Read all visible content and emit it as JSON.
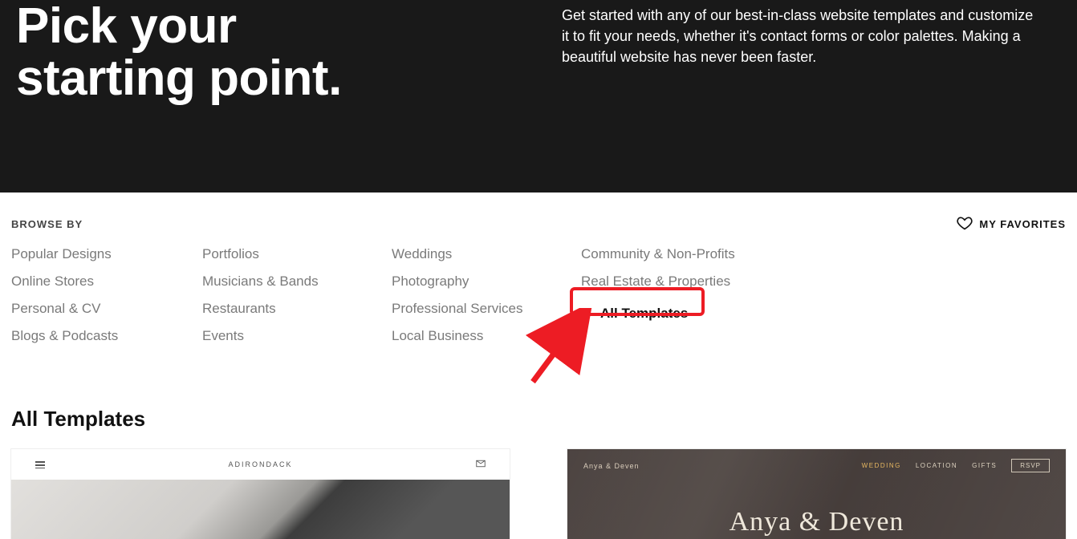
{
  "hero": {
    "title_line1": "Pick your",
    "title_line2": "starting point.",
    "description": "Get started with any of our best-in-class website templates and customize it to fit your needs, whether it's contact forms or color palettes. Making a beautiful website has never been faster."
  },
  "browse": {
    "label": "BROWSE BY",
    "favorites_label": "MY FAVORITES",
    "columns": [
      [
        "Popular Designs",
        "Online Stores",
        "Personal & CV",
        "Blogs & Podcasts"
      ],
      [
        "Portfolios",
        "Musicians & Bands",
        "Restaurants",
        "Events"
      ],
      [
        "Weddings",
        "Photography",
        "Professional Services",
        "Local Business"
      ],
      [
        "Community & Non-Profits",
        "Real Estate & Properties"
      ]
    ],
    "all_templates_label": "All Templates"
  },
  "section_title": "All Templates",
  "templates": {
    "adirondack": {
      "brand": "ADIRONDACK"
    },
    "anya": {
      "brand": "Anya & Deven",
      "nav": {
        "wedding": "WEDDING",
        "location": "LOCATION",
        "gifts": "GIFTS",
        "rsvp": "RSVP"
      },
      "title": "Anya & Deven"
    }
  }
}
